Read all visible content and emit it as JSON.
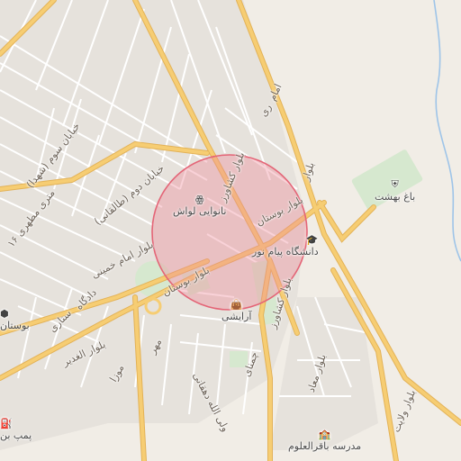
{
  "map": {
    "colors": {
      "background": "#f1ede6",
      "block": "#e6e2dc",
      "street": "#ffffff",
      "arterial": "#f6cd73",
      "arterial_edge": "#e3b257",
      "park": "#d6e8cf",
      "highlight_fill": "#f08a99",
      "highlight_stroke": "#e46577",
      "water": "#9ec4e8"
    },
    "highlight_area": "circle",
    "street_labels": [
      {
        "text": "بلوار کشاورز"
      },
      {
        "text": "بلوار بوستان"
      },
      {
        "text": "بلوار کشاورز"
      },
      {
        "text": "بلوار بوستان"
      },
      {
        "text": "بلوار امام خمینی"
      },
      {
        "text": "خیابان سوم (شهدا)"
      },
      {
        "text": "خیابان دوم (طالقانی)"
      },
      {
        "text": "۱۶ متری مطهری"
      },
      {
        "text": "دادگاه"
      },
      {
        "text": "ستاری"
      },
      {
        "text": "بلوار الغدیر"
      },
      {
        "text": "مهر"
      },
      {
        "text": "موزا"
      },
      {
        "text": "ولی الله دهقانی"
      },
      {
        "text": "چمنای"
      },
      {
        "text": "بلوار معاد"
      },
      {
        "text": "بلوار ولایت"
      },
      {
        "text": "بلوار"
      },
      {
        "text": "ری"
      },
      {
        "text": "امام"
      }
    ],
    "pois": [
      {
        "label": "نانوایی لواش",
        "icon": "bakery-icon"
      },
      {
        "label": "دانشگاه پیام نور",
        "icon": "university-icon"
      },
      {
        "label": "آرایشی",
        "icon": "shopping-bag-icon"
      },
      {
        "label": "باغ بهشت",
        "icon": "cemetery-icon"
      },
      {
        "label": "بوستان",
        "icon": "park-icon"
      },
      {
        "label": "مدرسه باقرالعلوم",
        "icon": "school-icon"
      },
      {
        "label": "پمپ بن",
        "icon": "fuel-pump-icon"
      }
    ],
    "icon_glyphs": [
      "ꙮ",
      "🎓",
      "👜",
      "⛨",
      "⬢",
      "🏫",
      "⛽"
    ]
  }
}
